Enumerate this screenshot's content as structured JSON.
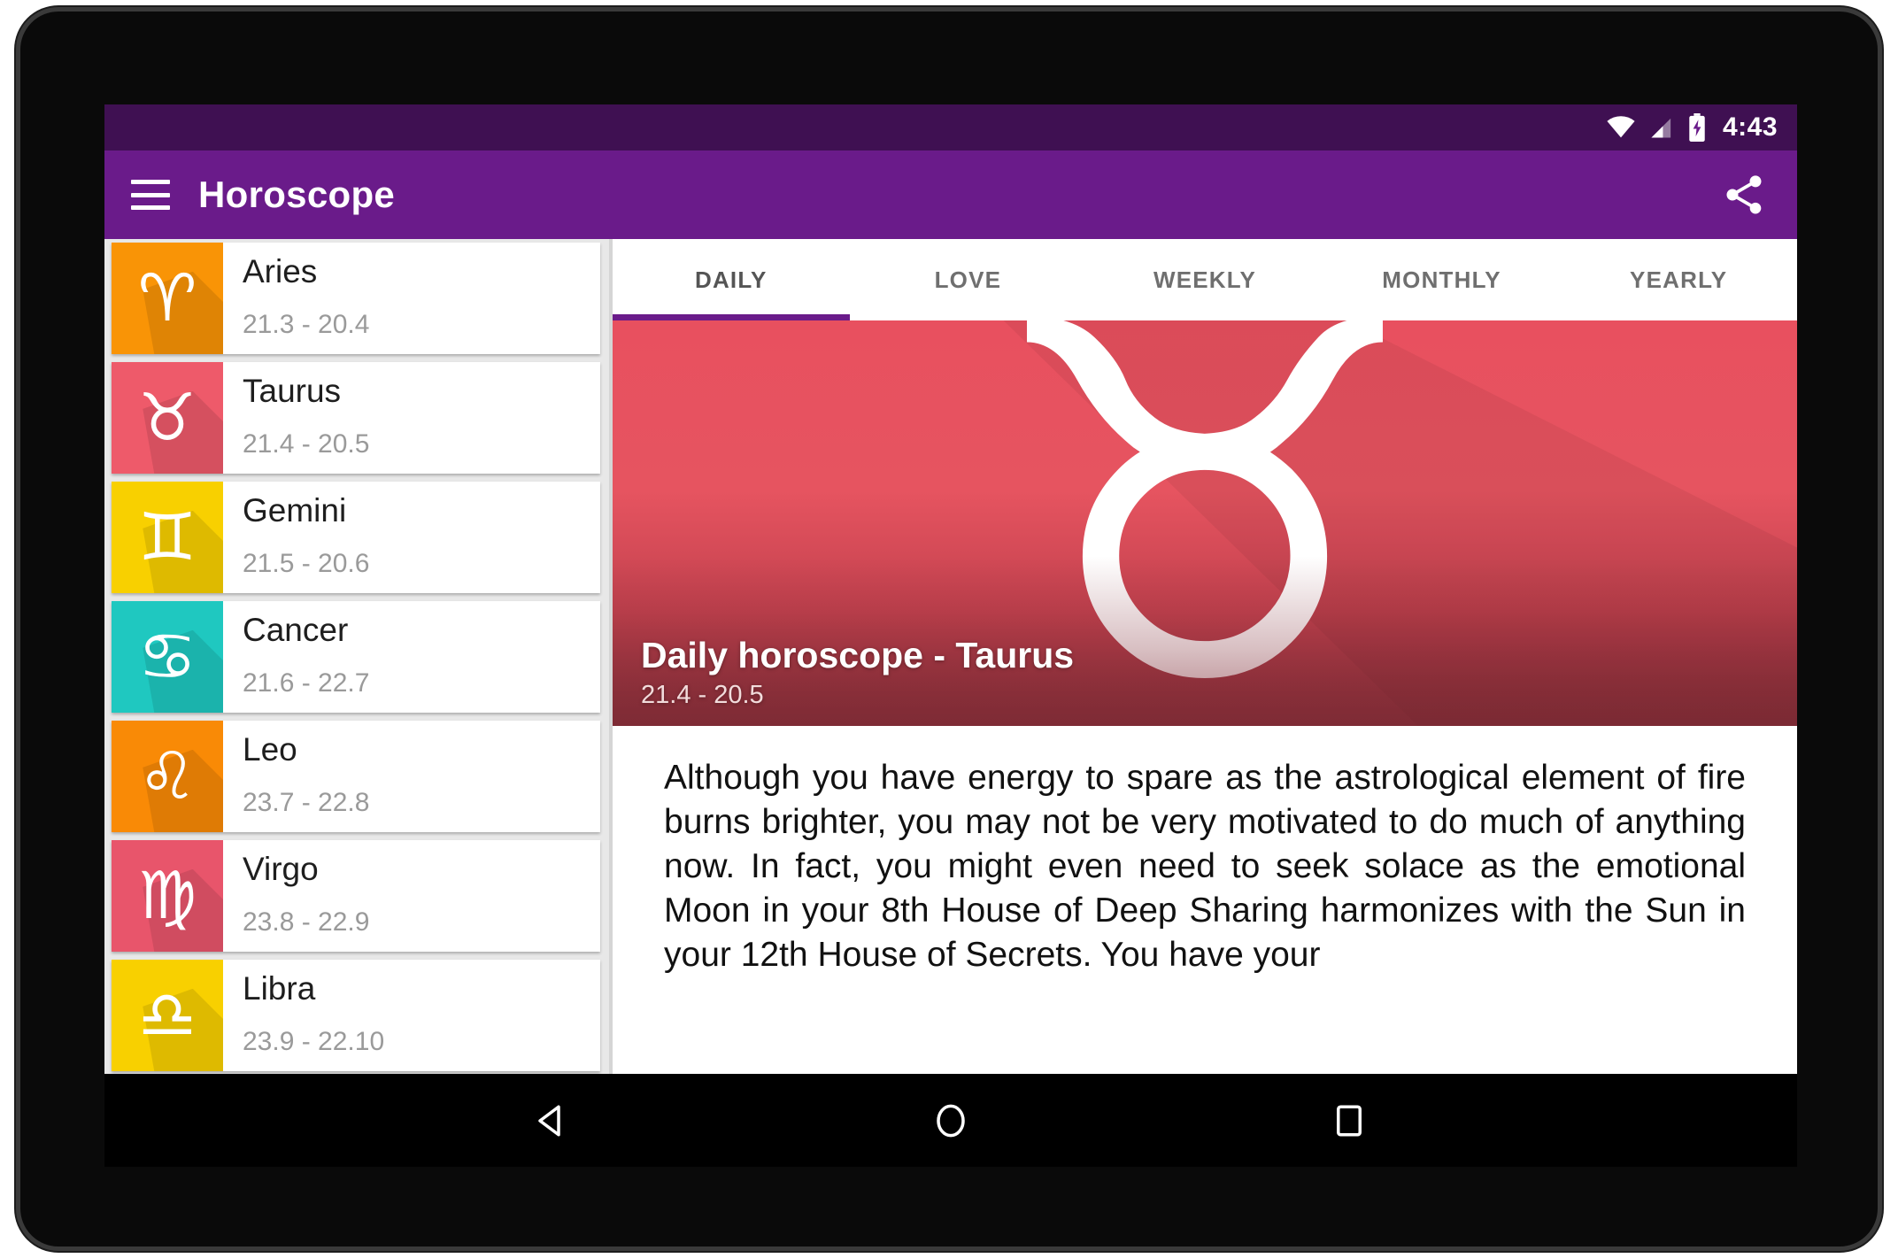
{
  "status_bar": {
    "time": "4:43",
    "icons": [
      "wifi-icon",
      "cellular-signal-icon",
      "battery-charging-icon"
    ]
  },
  "app_bar": {
    "title": "Horoscope",
    "menu_icon": "hamburger-menu-icon",
    "share_icon": "share-icon",
    "background_color": "#6A1B8A"
  },
  "sign_list": [
    {
      "name": "Aries",
      "dates": "21.3 - 20.4",
      "glyph": "♈",
      "color": "#F99406"
    },
    {
      "name": "Taurus",
      "dates": "21.4 - 20.5",
      "glyph": "♉",
      "color": "#EE5A6A"
    },
    {
      "name": "Gemini",
      "dates": "21.5 - 20.6",
      "glyph": "♊",
      "color": "#F8D000"
    },
    {
      "name": "Cancer",
      "dates": "21.6 - 22.7",
      "glyph": "♋",
      "color": "#1FC8C0"
    },
    {
      "name": "Leo",
      "dates": "23.7 - 22.8",
      "glyph": "♌",
      "color": "#F98A06"
    },
    {
      "name": "Virgo",
      "dates": "23.8 - 22.9",
      "glyph": "♍",
      "color": "#E8556B"
    },
    {
      "name": "Libra",
      "dates": "23.9 - 22.10",
      "glyph": "♎",
      "color": "#F8D000"
    }
  ],
  "tabs": [
    {
      "label": "DAILY",
      "active": true
    },
    {
      "label": "LOVE",
      "active": false
    },
    {
      "label": "WEEKLY",
      "active": false
    },
    {
      "label": "MONTHLY",
      "active": false
    },
    {
      "label": "YEARLY",
      "active": false
    }
  ],
  "hero": {
    "title": "Daily horoscope - Taurus",
    "dates": "21.4 - 20.5",
    "glyph": "♉",
    "top_color": "#E8505F",
    "bottom_color": "#7E2B35"
  },
  "reading": {
    "text": "Although you have energy to spare as the astrological element of fire burns brighter, you may not be very motivated to do much of anything now. In fact, you might even need to seek solace as the emotional Moon in your 8th House of Deep Sharing harmonizes with the Sun in your 12th House of Secrets. You have your"
  },
  "nav_bar": {
    "back": "back-triangle-icon",
    "home": "home-circle-icon",
    "recents": "recents-square-icon"
  }
}
